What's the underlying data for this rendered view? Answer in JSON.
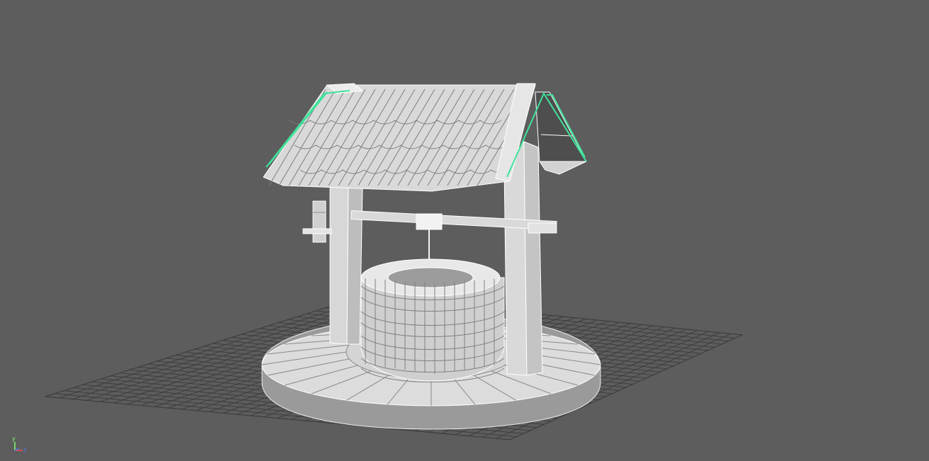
{
  "viewport": {
    "background": "#5d5d5d",
    "wire_color": "#2b2b2b",
    "mesh_fill": "#d9d9d9",
    "mesh_edge": "#ffffff",
    "selection_color": "#3fe29a",
    "grid_color": "#3d3d3d"
  },
  "axis_gizmo": {
    "y_label": "y",
    "z_label": "z",
    "y_color": "#7cff6a",
    "z_color": "#4a78ff",
    "x_color": "#ff4a4a"
  },
  "model": {
    "icon": "wishing-well-mesh",
    "selected_parts": [
      "roof-left-edge",
      "roof-right-gable"
    ]
  }
}
